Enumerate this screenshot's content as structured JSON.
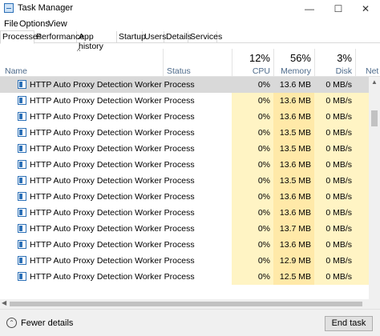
{
  "window": {
    "title": "Task Manager",
    "controls": {
      "minimize": "—",
      "maximize": "☐",
      "close": "✕"
    }
  },
  "menu": [
    "File",
    "Options",
    "View"
  ],
  "tabs": [
    "Processes",
    "Performance",
    "App history",
    "Startup",
    "Users",
    "Details",
    "Services"
  ],
  "active_tab": "Processes",
  "columns": {
    "name": "Name",
    "status": "Status",
    "cpu": {
      "percent": "12%",
      "label": "CPU"
    },
    "memory": {
      "percent": "56%",
      "label": "Memory"
    },
    "disk": {
      "percent": "3%",
      "label": "Disk"
    },
    "network": {
      "label": "Net"
    }
  },
  "rows": [
    {
      "name": "HTTP Auto Proxy Detection Worker Process",
      "cpu": "0%",
      "memory": "13.6 MB",
      "disk": "0 MB/s",
      "selected": true
    },
    {
      "name": "HTTP Auto Proxy Detection Worker Process",
      "cpu": "0%",
      "memory": "13.6 MB",
      "disk": "0 MB/s"
    },
    {
      "name": "HTTP Auto Proxy Detection Worker Process",
      "cpu": "0%",
      "memory": "13.6 MB",
      "disk": "0 MB/s"
    },
    {
      "name": "HTTP Auto Proxy Detection Worker Process",
      "cpu": "0%",
      "memory": "13.5 MB",
      "disk": "0 MB/s"
    },
    {
      "name": "HTTP Auto Proxy Detection Worker Process",
      "cpu": "0%",
      "memory": "13.5 MB",
      "disk": "0 MB/s"
    },
    {
      "name": "HTTP Auto Proxy Detection Worker Process",
      "cpu": "0%",
      "memory": "13.6 MB",
      "disk": "0 MB/s"
    },
    {
      "name": "HTTP Auto Proxy Detection Worker Process",
      "cpu": "0%",
      "memory": "13.5 MB",
      "disk": "0 MB/s"
    },
    {
      "name": "HTTP Auto Proxy Detection Worker Process",
      "cpu": "0%",
      "memory": "13.6 MB",
      "disk": "0 MB/s"
    },
    {
      "name": "HTTP Auto Proxy Detection Worker Process",
      "cpu": "0%",
      "memory": "13.6 MB",
      "disk": "0 MB/s"
    },
    {
      "name": "HTTP Auto Proxy Detection Worker Process",
      "cpu": "0%",
      "memory": "13.7 MB",
      "disk": "0 MB/s"
    },
    {
      "name": "HTTP Auto Proxy Detection Worker Process",
      "cpu": "0%",
      "memory": "13.6 MB",
      "disk": "0 MB/s"
    },
    {
      "name": "HTTP Auto Proxy Detection Worker Process",
      "cpu": "0%",
      "memory": "12.9 MB",
      "disk": "0 MB/s"
    },
    {
      "name": "HTTP Auto Proxy Detection Worker Process",
      "cpu": "0%",
      "memory": "12.5 MB",
      "disk": "0 MB/s"
    }
  ],
  "footer": {
    "fewer_details": "Fewer details",
    "end_task": "End task"
  },
  "colors": {
    "heat_light": "#fff4c4",
    "heat_medium": "#ffe9a8",
    "selected_row": "#d9d9d9",
    "header_label": "#4d6a8a"
  },
  "icons": {
    "app": "task-manager-icon",
    "process": "process-window-icon",
    "fewer_details": "chevron-up-circle-icon",
    "sort": "sort-ascending-icon"
  }
}
